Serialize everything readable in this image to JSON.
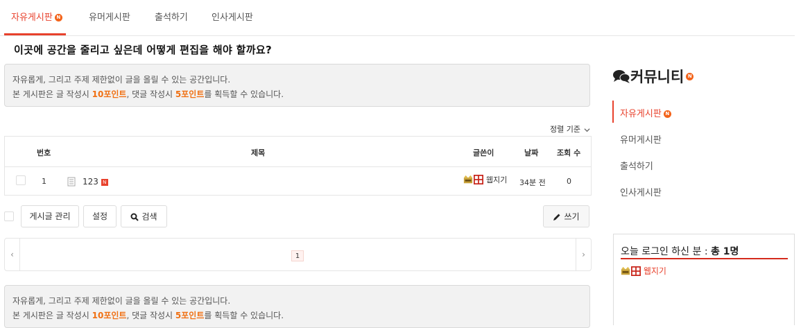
{
  "tabs": [
    {
      "label": "자유게시판",
      "badge": "N",
      "active": true
    },
    {
      "label": "유머게시판",
      "active": false
    },
    {
      "label": "출석하기",
      "active": false
    },
    {
      "label": "인사게시판",
      "active": false
    }
  ],
  "heading": "이곳에 공간을 줄리고 싶은데 어떻게 편집을 해야 할까요?",
  "notice": {
    "line1": "자유롭게, 그리고 주제 제한없이 글을 올릴 수 있는 공간입니다.",
    "line2_pre": "본 게시판은 글 작성시 ",
    "post_points": "10포인트",
    "line2_mid": ", 댓글 작성시 ",
    "comment_points": "5포인트",
    "line2_post": "를 획득할 수 있습니다."
  },
  "sort_label": "정렬 기준",
  "table": {
    "headers": {
      "num": "번호",
      "title": "제목",
      "author": "글쓴이",
      "date": "날짜",
      "views": "조회 수"
    },
    "rows": [
      {
        "num": "1",
        "title": "123",
        "badge": "N",
        "author": "웹지기",
        "date": "34분 전",
        "views": "0"
      }
    ]
  },
  "buttons": {
    "manage": "게시글 관리",
    "settings": "설정",
    "search": "검색",
    "write": "쓰기"
  },
  "pagination": {
    "current": "1"
  },
  "sidebar": {
    "title": "커뮤니티",
    "title_badge": "N",
    "items": [
      {
        "label": "자유게시판",
        "badge": "N",
        "active": true
      },
      {
        "label": "유머게시판"
      },
      {
        "label": "출석하기"
      },
      {
        "label": "인사게시판"
      }
    ],
    "login": {
      "title_pre": "오늘 로그인 하신 분 : ",
      "title_count": "총 1명",
      "user": "웹지기"
    }
  },
  "colors": {
    "accent": "#e8412c",
    "points": "#f07013",
    "badge": "#f3631a"
  },
  "icons": {
    "community": "chat-bubbles-icon",
    "write": "pencil-icon",
    "search": "magnifier-icon",
    "post": "document-icon",
    "user_level": "crown-icon"
  }
}
